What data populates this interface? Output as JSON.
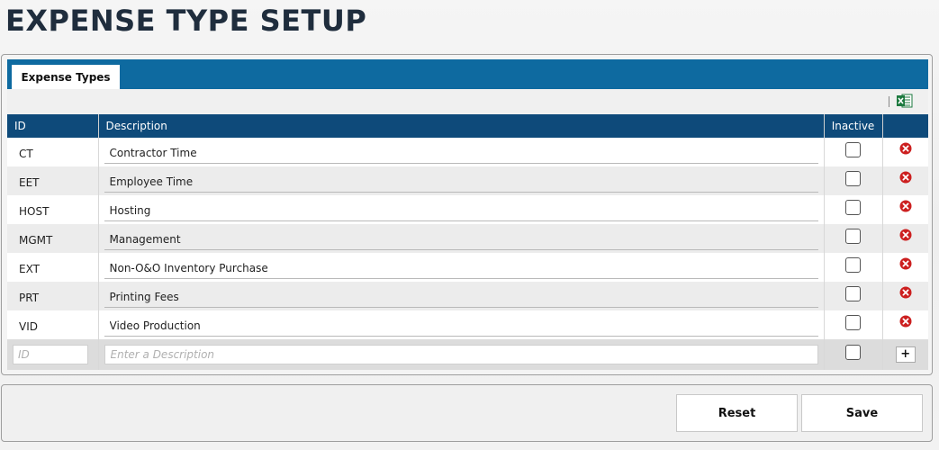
{
  "page": {
    "title": "EXPENSE TYPE SETUP"
  },
  "tabs": [
    {
      "label": "Expense Types"
    }
  ],
  "toolbar": {
    "export_icon": "excel-icon"
  },
  "table": {
    "columns": {
      "id": "ID",
      "description": "Description",
      "inactive": "Inactive",
      "actions": ""
    },
    "rows": [
      {
        "id": "CT",
        "description": "Contractor Time",
        "inactive": false
      },
      {
        "id": "EET",
        "description": "Employee Time",
        "inactive": false
      },
      {
        "id": "HOST",
        "description": "Hosting",
        "inactive": false
      },
      {
        "id": "MGMT",
        "description": "Management",
        "inactive": false
      },
      {
        "id": "EXT",
        "description": "Non-O&O Inventory Purchase",
        "inactive": false
      },
      {
        "id": "PRT",
        "description": "Printing Fees",
        "inactive": false
      },
      {
        "id": "VID",
        "description": "Video Production",
        "inactive": false
      }
    ],
    "new_row": {
      "id_placeholder": "ID",
      "description_placeholder": "Enter a Description",
      "add_label": "+"
    }
  },
  "footer": {
    "reset_label": "Reset",
    "save_label": "Save"
  },
  "colors": {
    "tab_bar": "#0e6aa0",
    "header_bg": "#0e4a7a",
    "delete_icon": "#cc1f1f",
    "excel_icon": "#1d7a3f"
  }
}
